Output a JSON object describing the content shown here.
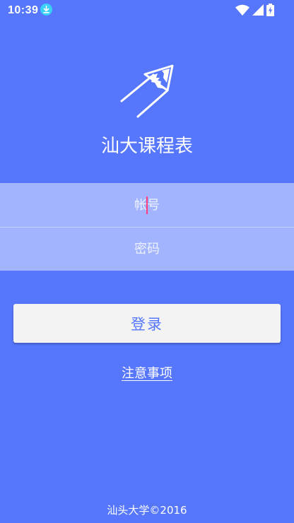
{
  "status_bar": {
    "time": "10:39",
    "icons": [
      "download-icon",
      "wifi-icon",
      "signal-icon",
      "battery-charging-icon"
    ]
  },
  "app": {
    "title": "汕大课程表",
    "logo_icon": "pencil-rocket-icon"
  },
  "login_form": {
    "account_placeholder": "帐号",
    "password_placeholder": "密码",
    "account_value": "",
    "password_value": "",
    "login_label": "登录",
    "notice_label": "注意事项"
  },
  "footer": {
    "text": "汕头大学©2016"
  },
  "colors": {
    "background": "#5677fc",
    "input_background": "#a1b4fd",
    "button_background": "#f3f3f3",
    "button_text": "#5677fc",
    "caret": "#ff3d7f"
  }
}
